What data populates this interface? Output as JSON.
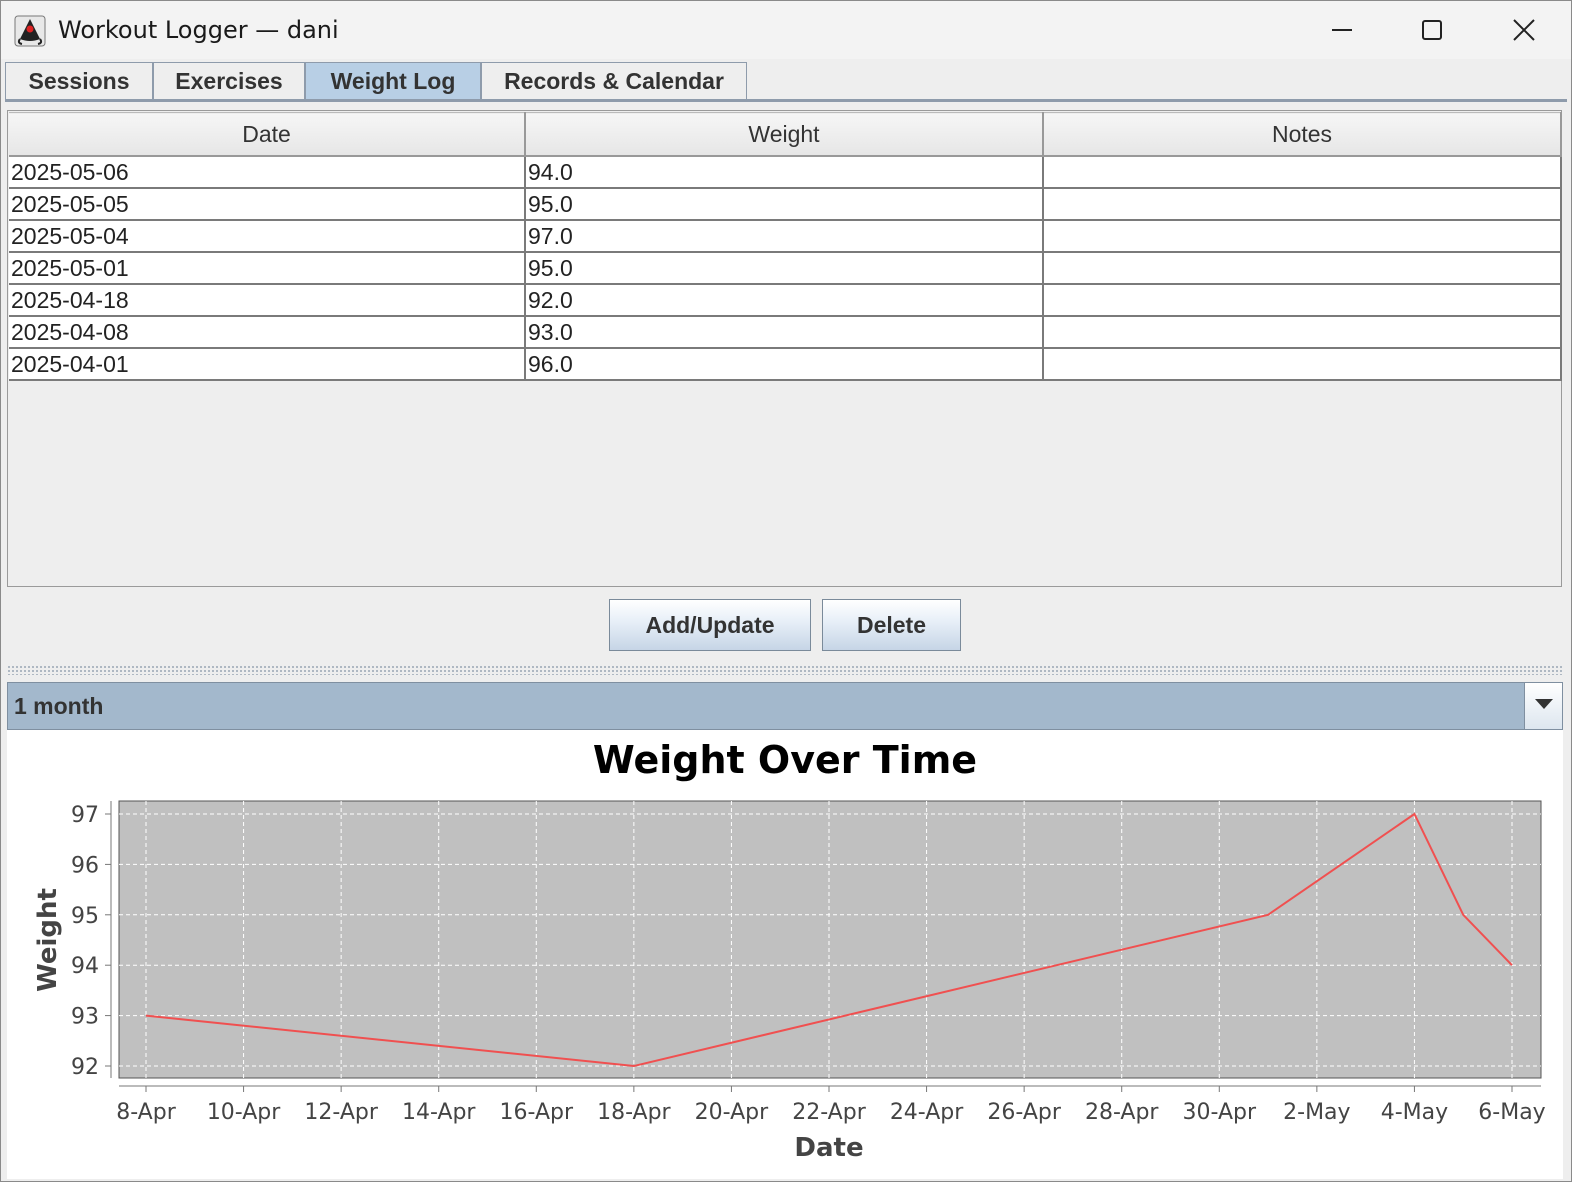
{
  "window": {
    "title": "Workout Logger — dani"
  },
  "tabs": [
    {
      "label": "Sessions",
      "selected": false
    },
    {
      "label": "Exercises",
      "selected": false
    },
    {
      "label": "Weight Log",
      "selected": true
    },
    {
      "label": "Records & Calendar",
      "selected": false
    }
  ],
  "table": {
    "columns": [
      "Date",
      "Weight",
      "Notes"
    ],
    "rows": [
      {
        "date": "2025-05-06",
        "weight": "94.0",
        "notes": ""
      },
      {
        "date": "2025-05-05",
        "weight": "95.0",
        "notes": ""
      },
      {
        "date": "2025-05-04",
        "weight": "97.0",
        "notes": ""
      },
      {
        "date": "2025-05-01",
        "weight": "95.0",
        "notes": ""
      },
      {
        "date": "2025-04-18",
        "weight": "92.0",
        "notes": ""
      },
      {
        "date": "2025-04-08",
        "weight": "93.0",
        "notes": ""
      },
      {
        "date": "2025-04-01",
        "weight": "96.0",
        "notes": ""
      }
    ]
  },
  "buttons": {
    "add_update": "Add/Update",
    "delete": "Delete"
  },
  "range_select": {
    "value": "1 month"
  },
  "icons": {
    "app": "java-duke-icon",
    "minimize": "minimize-icon",
    "maximize": "maximize-icon",
    "close": "close-icon",
    "dropdown": "chevron-down-icon"
  },
  "colors": {
    "selected_tab": "#b8cfe5",
    "combo_bg": "#a3b8cc",
    "plot_bg": "#c0c0c0",
    "series_line": "#f05050"
  },
  "chart_data": {
    "type": "line",
    "title": "Weight Over Time",
    "xlabel": "Date",
    "ylabel": "Weight",
    "x_ticks": [
      "8-Apr",
      "10-Apr",
      "12-Apr",
      "14-Apr",
      "16-Apr",
      "18-Apr",
      "20-Apr",
      "22-Apr",
      "24-Apr",
      "26-Apr",
      "28-Apr",
      "30-Apr",
      "2-May",
      "4-May",
      "6-May"
    ],
    "y_ticks": [
      92,
      93,
      94,
      95,
      96,
      97
    ],
    "xlim": [
      "2025-04-07",
      "2025-05-06"
    ],
    "ylim": [
      91.75,
      97.25
    ],
    "grid": true,
    "legend": false,
    "series": [
      {
        "points": [
          {
            "x": "2025-04-08",
            "y": 93.0
          },
          {
            "x": "2025-04-18",
            "y": 92.0
          },
          {
            "x": "2025-05-01",
            "y": 95.0
          },
          {
            "x": "2025-05-04",
            "y": 97.0
          },
          {
            "x": "2025-05-05",
            "y": 95.0
          },
          {
            "x": "2025-05-06",
            "y": 94.0
          }
        ]
      }
    ]
  }
}
